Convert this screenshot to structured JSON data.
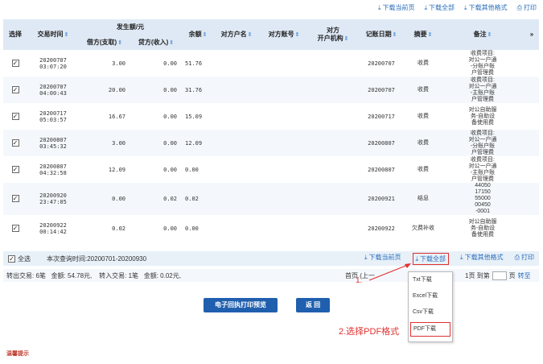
{
  "top_links": [
    {
      "icon": "download-icon",
      "label": "下载当前页"
    },
    {
      "icon": "download-icon",
      "label": "下载全部"
    },
    {
      "icon": "download-icon",
      "label": "下载其他格式"
    },
    {
      "icon": "print-icon",
      "label": "打印"
    }
  ],
  "table": {
    "headers": {
      "select": "选择",
      "time": "交易时间",
      "amount_group": "发生额/元",
      "debit": "借方(支取)",
      "credit": "贷方(收入)",
      "balance": "余额",
      "counter_name": "对方户名",
      "counter_account": "对方账号",
      "counter_bank": "对方\n开户机构",
      "book_date": "记账日期",
      "summary": "摘要",
      "remark": "备注",
      "more": "»"
    },
    "rows": [
      {
        "date": "20200707",
        "time": "03:07:20",
        "debit": "3.00",
        "credit": "0.00",
        "balance": "51.76",
        "book_date": "20200707",
        "summary": "收费",
        "remark": "收费项目:\n对公一户通\n-分账户账\n户管理费"
      },
      {
        "date": "20200707",
        "time": "04:00:43",
        "debit": "20.00",
        "credit": "0.00",
        "balance": "31.76",
        "book_date": "20200707",
        "summary": "收费",
        "remark": "收费项目:\n对公一户通\n-主账户账\n户管理费"
      },
      {
        "date": "20200717",
        "time": "05:03:57",
        "debit": "16.67",
        "credit": "0.00",
        "balance": "15.09",
        "book_date": "20200717",
        "summary": "收费",
        "remark": "对公自助服\n务-自助设\n备使用费"
      },
      {
        "date": "20200807",
        "time": "03:45:32",
        "debit": "3.00",
        "credit": "0.00",
        "balance": "12.09",
        "book_date": "20200807",
        "summary": "收费",
        "remark": "收费项目:\n对公一户通\n-分账户账\n户管理费"
      },
      {
        "date": "20200807",
        "time": "04:32:58",
        "debit": "12.09",
        "credit": "0.00",
        "balance": "0.00",
        "book_date": "20200807",
        "summary": "收费",
        "remark": "收费项目:\n对公一户通\n-主账户账\n户管理费"
      },
      {
        "date": "20200920",
        "time": "23:47:05",
        "debit": "0.00",
        "credit": "0.02",
        "balance": "0.02",
        "book_date": "20200921",
        "summary": "结息",
        "remark": "44050\n17150\n55000\n00450\n-0001"
      },
      {
        "date": "20200922",
        "time": "00:14:42",
        "debit": "0.02",
        "credit": "0.00",
        "balance": "0.00",
        "book_date": "20200922",
        "summary": "欠费补收",
        "remark": "对公自助服\n务-自助设\n备使用费"
      }
    ]
  },
  "footer": {
    "select_all": "全选",
    "query_range": "本次查询时间:20200701-20200930",
    "links": [
      {
        "icon": "download-icon",
        "label": "下载当前页"
      },
      {
        "icon": "download-icon",
        "label": "下载全部"
      },
      {
        "icon": "download-icon",
        "label": "下载其他格式"
      },
      {
        "icon": "print-icon",
        "label": "打印"
      }
    ],
    "summary": "转出交易: 6笔   金额: 54.78元,    转入交易: 1笔   金额: 0.02元,",
    "pager_left": "首页 (上一",
    "pager_mid": "1页  到第",
    "pager_unit": "页",
    "go": "转至"
  },
  "buttons": {
    "print_preview": "电子回执打印预览",
    "back": "返 回"
  },
  "dropdown": {
    "options": [
      "Txt下载",
      "Excel下载",
      "Csv下载",
      "PDF下载"
    ]
  },
  "annotations": {
    "step1": "1.",
    "step2": "2.选择PDF格式"
  },
  "tips": "温馨提示",
  "colors": {
    "accent": "#2a6ebb",
    "button": "#1f5fae",
    "annotation": "#e03030",
    "header_bg": "#dfe9f5"
  }
}
